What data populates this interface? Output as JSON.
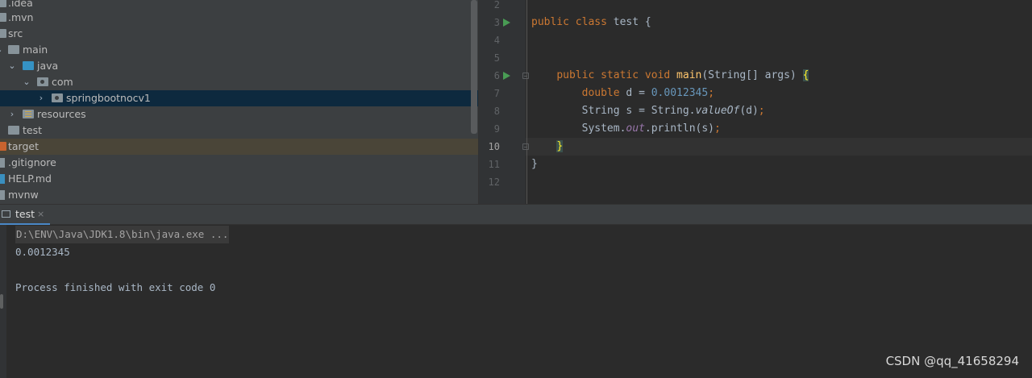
{
  "project_tree": {
    "items": [
      {
        "label": ".idea"
      },
      {
        "label": ".mvn"
      },
      {
        "label": "src"
      },
      {
        "label": "main"
      },
      {
        "label": "java"
      },
      {
        "label": "com"
      },
      {
        "label": "springbootnocv1"
      },
      {
        "label": "resources"
      },
      {
        "label": "test"
      },
      {
        "label": "target"
      },
      {
        "label": ".gitignore"
      },
      {
        "label": "HELP.md"
      },
      {
        "label": "mvnw"
      }
    ]
  },
  "editor": {
    "line_numbers": [
      "2",
      "3",
      "4",
      "5",
      "6",
      "7",
      "8",
      "9",
      "10",
      "11",
      "12"
    ],
    "active_line": "10",
    "code": {
      "l3_public": "public",
      "l3_class": "class",
      "l3_rest": " test {",
      "l6_public": "public",
      "l6_static": "static",
      "l6_void": "void",
      "l6_main": "main",
      "l6_params": "(String[] args) ",
      "l6_brace": "{",
      "l7_double": "double",
      "l7_var": " d = ",
      "l7_num": "0.0012345",
      "l7_semi": ";",
      "l8_a": "String s = String.",
      "l8_method": "valueOf",
      "l8_b": "(d)",
      "l8_semi": ";",
      "l9_a": "System.",
      "l9_out": "out",
      "l9_b": ".println(s)",
      "l9_semi": ";",
      "l10_brace": "}",
      "l11_brace": "}"
    }
  },
  "run_panel": {
    "tab_label": "test",
    "tab_close": "×",
    "output": {
      "command": "D:\\ENV\\Java\\JDK1.8\\bin\\java.exe ...",
      "value": "0.0012345",
      "exit": "Process finished with exit code 0"
    }
  },
  "watermark": "CSDN @qq_41658294",
  "colors": {
    "keyword": "#cc7832",
    "method": "#ffc66d",
    "number": "#6897bb",
    "static_field": "#9876aa",
    "selection": "#0d293e",
    "run_icon": "#499c54"
  }
}
